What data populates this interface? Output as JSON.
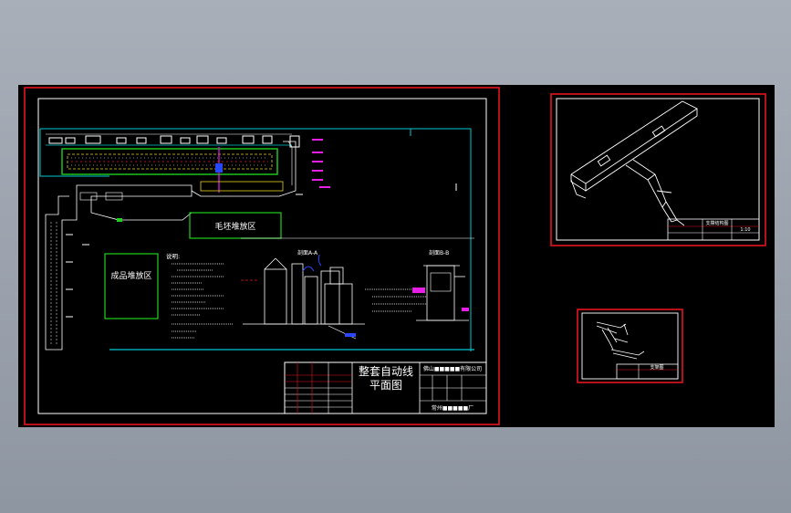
{
  "colors": {
    "background": "#000000",
    "frame_red": "#e4141e",
    "line_white": "#ffffff",
    "line_cyan": "#00c8d2",
    "line_green": "#1ed21e",
    "line_yellow": "#e6d21e",
    "line_magenta": "#e61ee6",
    "line_blue": "#2848ff"
  },
  "main_drawing": {
    "title_line1": "整套自动线",
    "title_line2": "平面图",
    "company": "佛山■■■■■有限公司",
    "client": "常州■■■■■厂",
    "zone_finished": "成品堆放区",
    "zone_blank": "毛坯堆放区",
    "notes_title": "说明:",
    "section_a": "剖面A-A",
    "section_b": "剖面B-B"
  },
  "detail_1": {
    "title": "支撑结构图",
    "scale": "1:10"
  },
  "detail_2": {
    "title": "支架图"
  },
  "icons": [
    "crossbeam-3d-icon",
    "bracket-3d-icon"
  ]
}
